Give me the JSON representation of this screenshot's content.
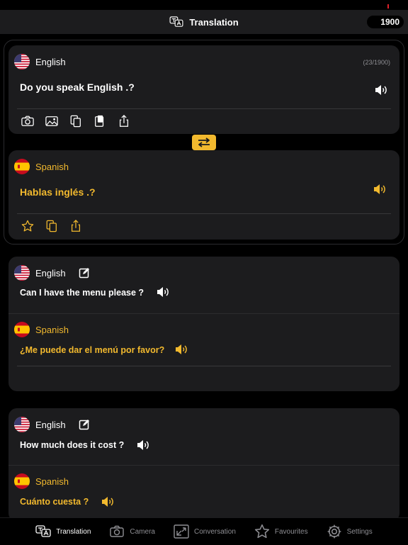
{
  "header": {
    "title": "Translation",
    "credits": "1900"
  },
  "current": {
    "source": {
      "language": "English",
      "counter": "(23/1900)",
      "text": "Do you speak English .?"
    },
    "target": {
      "language": "Spanish",
      "text": "Hablas inglés .?"
    }
  },
  "history": [
    {
      "source_language": "English",
      "source_text": "Can I have the menu please ?",
      "target_language": "Spanish",
      "target_text": "¿Me puede dar el menú por favor?"
    },
    {
      "source_language": "English",
      "source_text": "How much does it cost ?",
      "target_language": "Spanish",
      "target_text": "Cuánto cuesta ?"
    }
  ],
  "tabs": [
    {
      "label": "Translation",
      "icon": "translate-icon",
      "active": true
    },
    {
      "label": "Camera",
      "icon": "camera-icon"
    },
    {
      "label": "Conversation",
      "icon": "conversation-icon"
    },
    {
      "label": "Favourites",
      "icon": "star-icon"
    },
    {
      "label": "Settings",
      "icon": "gear-icon"
    }
  ],
  "colors": {
    "accent": "#f2b92e",
    "card": "#1c1c1e",
    "background": "#000000"
  }
}
